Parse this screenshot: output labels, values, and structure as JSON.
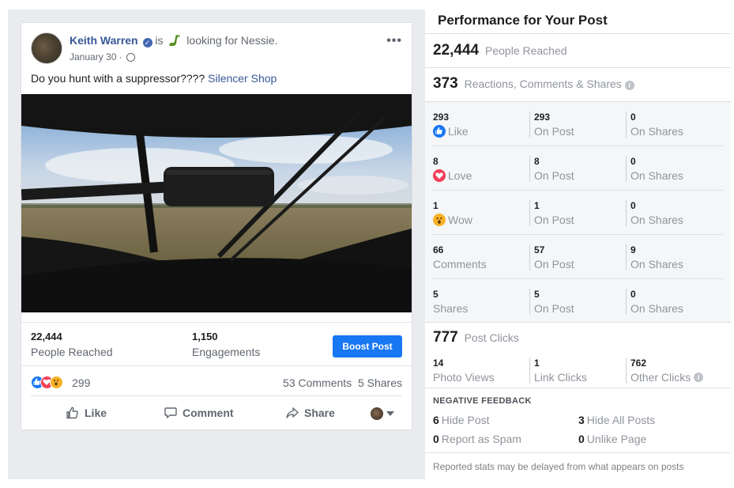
{
  "post": {
    "author": "Keith Warren",
    "feeling_prefix": "is",
    "feeling_text": "looking for Nessie.",
    "date": "January 30 ·",
    "text": "Do you hunt with a suppressor????",
    "link_text": "Silencer Shop",
    "stats": {
      "reached_value": "22,444",
      "reached_label": "People Reached",
      "engagements_value": "1,150",
      "engagements_label": "Engagements"
    },
    "boost_label": "Boost Post",
    "reaction_count": "299",
    "comments_shares": "53 Comments  5 Shares",
    "actions": {
      "like": "Like",
      "comment": "Comment",
      "share": "Share"
    }
  },
  "performance": {
    "title": "Performance for Your Post",
    "people_reached_value": "22,444",
    "people_reached_label": "People Reached",
    "engagement_value": "373",
    "engagement_label": "Reactions, Comments & Shares",
    "breakdown": [
      {
        "total": "293",
        "label": "Like",
        "on_post": "293",
        "on_post_label": "On Post",
        "on_shares": "0",
        "on_shares_label": "On Shares"
      },
      {
        "total": "8",
        "label": "Love",
        "on_post": "8",
        "on_post_label": "On Post",
        "on_shares": "0",
        "on_shares_label": "On Shares"
      },
      {
        "total": "1",
        "label": "Wow",
        "on_post": "1",
        "on_post_label": "On Post",
        "on_shares": "0",
        "on_shares_label": "On Shares"
      },
      {
        "total": "66",
        "label": "Comments",
        "on_post": "57",
        "on_post_label": "On Post",
        "on_shares": "9",
        "on_shares_label": "On Shares"
      },
      {
        "total": "5",
        "label": "Shares",
        "on_post": "5",
        "on_post_label": "On Post",
        "on_shares": "0",
        "on_shares_label": "On Shares"
      }
    ],
    "post_clicks_value": "777",
    "post_clicks_label": "Post Clicks",
    "clicks": [
      {
        "value": "14",
        "label": "Photo Views"
      },
      {
        "value": "1",
        "label": "Link Clicks"
      },
      {
        "value": "762",
        "label": "Other Clicks"
      }
    ],
    "negative_title": "NEGATIVE FEEDBACK",
    "negative": [
      {
        "value": "6",
        "label": "Hide Post"
      },
      {
        "value": "3",
        "label": "Hide All Posts"
      },
      {
        "value": "0",
        "label": "Report as Spam"
      },
      {
        "value": "0",
        "label": "Unlike Page"
      }
    ],
    "footnote": "Reported stats may be delayed from what appears on posts"
  },
  "colors": {
    "link": "#385898",
    "boost": "#1877f2",
    "like": "#1877f2",
    "love": "#f33e58",
    "wow": "#f7b125"
  }
}
